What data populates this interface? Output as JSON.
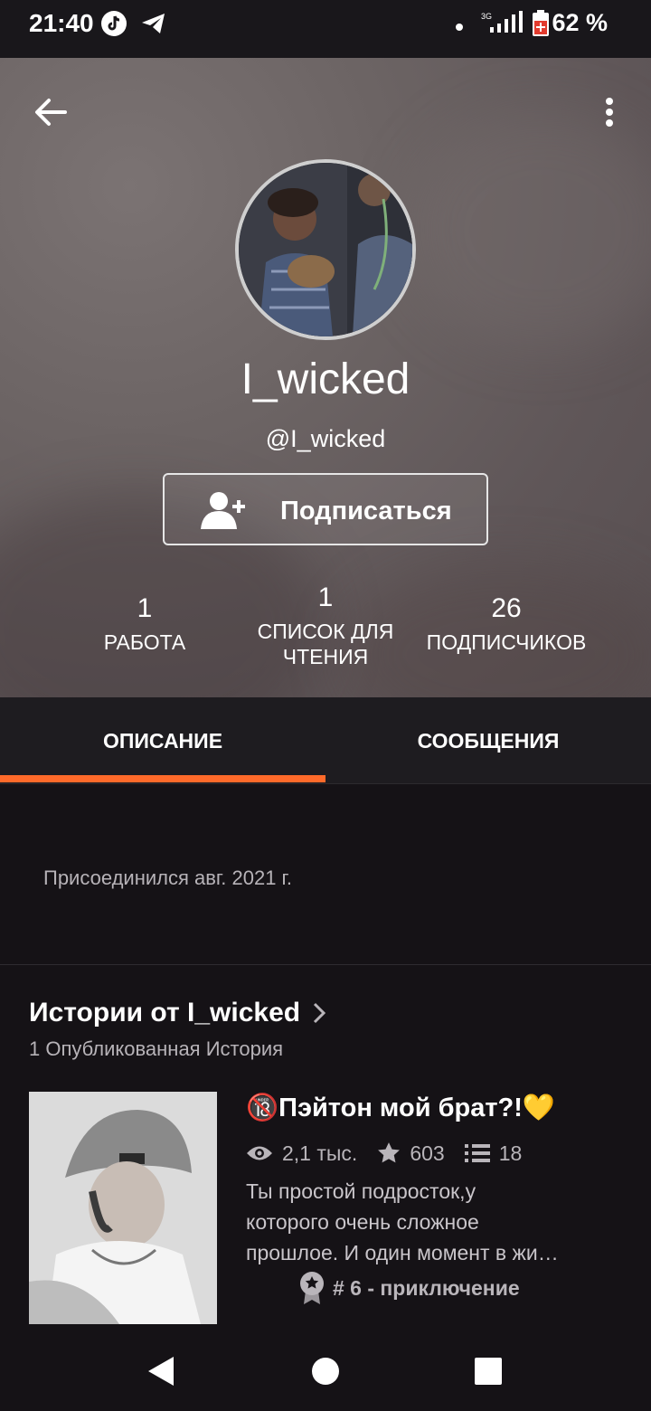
{
  "status_bar": {
    "time": "21:40",
    "battery": "62 %",
    "icons": [
      "tiktok-icon",
      "telegram-icon",
      "dot-icon",
      "signal-3g-icon",
      "battery-icon"
    ]
  },
  "profile": {
    "display_name": "I_wicked",
    "handle": "@I_wicked",
    "follow_label": "Подписаться",
    "stats": [
      {
        "value": "1",
        "label": "РАБОТА"
      },
      {
        "value": "1",
        "label": "СПИСОК ДЛЯ ЧТЕНИЯ"
      },
      {
        "value": "26",
        "label": "ПОДПИСЧИКОВ"
      }
    ]
  },
  "tabs": [
    {
      "label": "ОПИСАНИЕ",
      "active": true
    },
    {
      "label": "СООБЩЕНИЯ",
      "active": false
    }
  ],
  "about": {
    "joined": "Присоединился авг. 2021 г."
  },
  "stories": {
    "title": "Истории от I_wicked",
    "subtitle": "1 Опубликованная История",
    "items": [
      {
        "badge": "🔞",
        "title": "Пэйтон мой брат?!",
        "emoji": "💛",
        "views": "2,1 тыс.",
        "votes": "603",
        "parts": "18",
        "description_lines": [
          "Ты простой подросток,у",
          "которого очень сложное",
          "прошлое. И один момент в жи…"
        ],
        "rank": "# 6 - приключение"
      }
    ]
  },
  "colors": {
    "accent": "#ff6a2a",
    "background": "#151216",
    "tab_bar": "#1e1c20"
  }
}
